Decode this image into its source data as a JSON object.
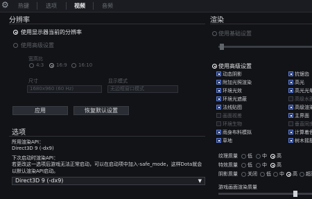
{
  "tabs": [
    "热键",
    "选项",
    "视频",
    "音频"
  ],
  "active_tab_index": 2,
  "resolution": {
    "title": "分辨率",
    "opt_monitor": "使用显示器当前的分辨率",
    "opt_advanced": "使用高级设置",
    "aspect_label": "宽高比",
    "aspect_options": [
      "4:3",
      "16:9",
      "16:10"
    ],
    "size_label": "尺寸",
    "size_value": "1680x960 (60 Hz)",
    "display_mode_label": "显示模式",
    "display_mode_value": "无边框窗口模式",
    "apply_button": "应用",
    "restore_button": "恢复默认设置"
  },
  "options": {
    "title": "选项",
    "api_label": "所用渲染API：",
    "api_value": "Direct3D 9 (-dx9)",
    "next_label": "下次启动时渲染API：",
    "next_desc": "若更改这一选项后游戏无法正常启动，可以在启动项中加入-safe_mode，这样Dota就会以默认渲染API启动。",
    "dropdown_value": "Direct3D 9 (-dx9)"
  },
  "render": {
    "title": "渲染",
    "opt_basic": "使用基础设置",
    "opt_advanced": "使用高级设置",
    "left_checks": [
      {
        "label": "动态阴影",
        "checked": true
      },
      {
        "label": "附加光照渲染",
        "checked": true
      },
      {
        "label": "环境光效",
        "checked": true
      },
      {
        "label": "环境光遮蔽",
        "checked": true
      },
      {
        "label": "法线贴图",
        "checked": true
      },
      {
        "label": "画面视差",
        "checked": false
      },
      {
        "label": "环境生物",
        "checked": false
      },
      {
        "label": "雨身布料模拟",
        "checked": true
      },
      {
        "label": "草地",
        "checked": true
      }
    ],
    "right_checks": [
      {
        "label": "抗锯齿",
        "checked": true
      },
      {
        "label": "高光",
        "checked": true
      },
      {
        "label": "高光光晕",
        "checked": true
      },
      {
        "label": "高级水面",
        "checked": false
      },
      {
        "label": "高级渲染",
        "checked": true
      },
      {
        "label": "主界面",
        "checked": true
      },
      {
        "label": "垂直同步",
        "checked": false
      },
      {
        "label": "计算着色",
        "checked": true
      },
      {
        "label": "树木摇摆",
        "checked": true
      }
    ],
    "quality_rows": [
      {
        "label": "纹理质量",
        "options": [
          "低",
          "中",
          "高"
        ],
        "selected": 2
      },
      {
        "label": "特效质量",
        "options": [
          "低",
          "中",
          "高"
        ],
        "selected": 2
      },
      {
        "label": "阴影质量",
        "options": [
          "关闭",
          "低",
          "中",
          "高",
          "超高"
        ],
        "selected": 3
      }
    ],
    "render_quality_label": "游戏画面渲染质量"
  }
}
